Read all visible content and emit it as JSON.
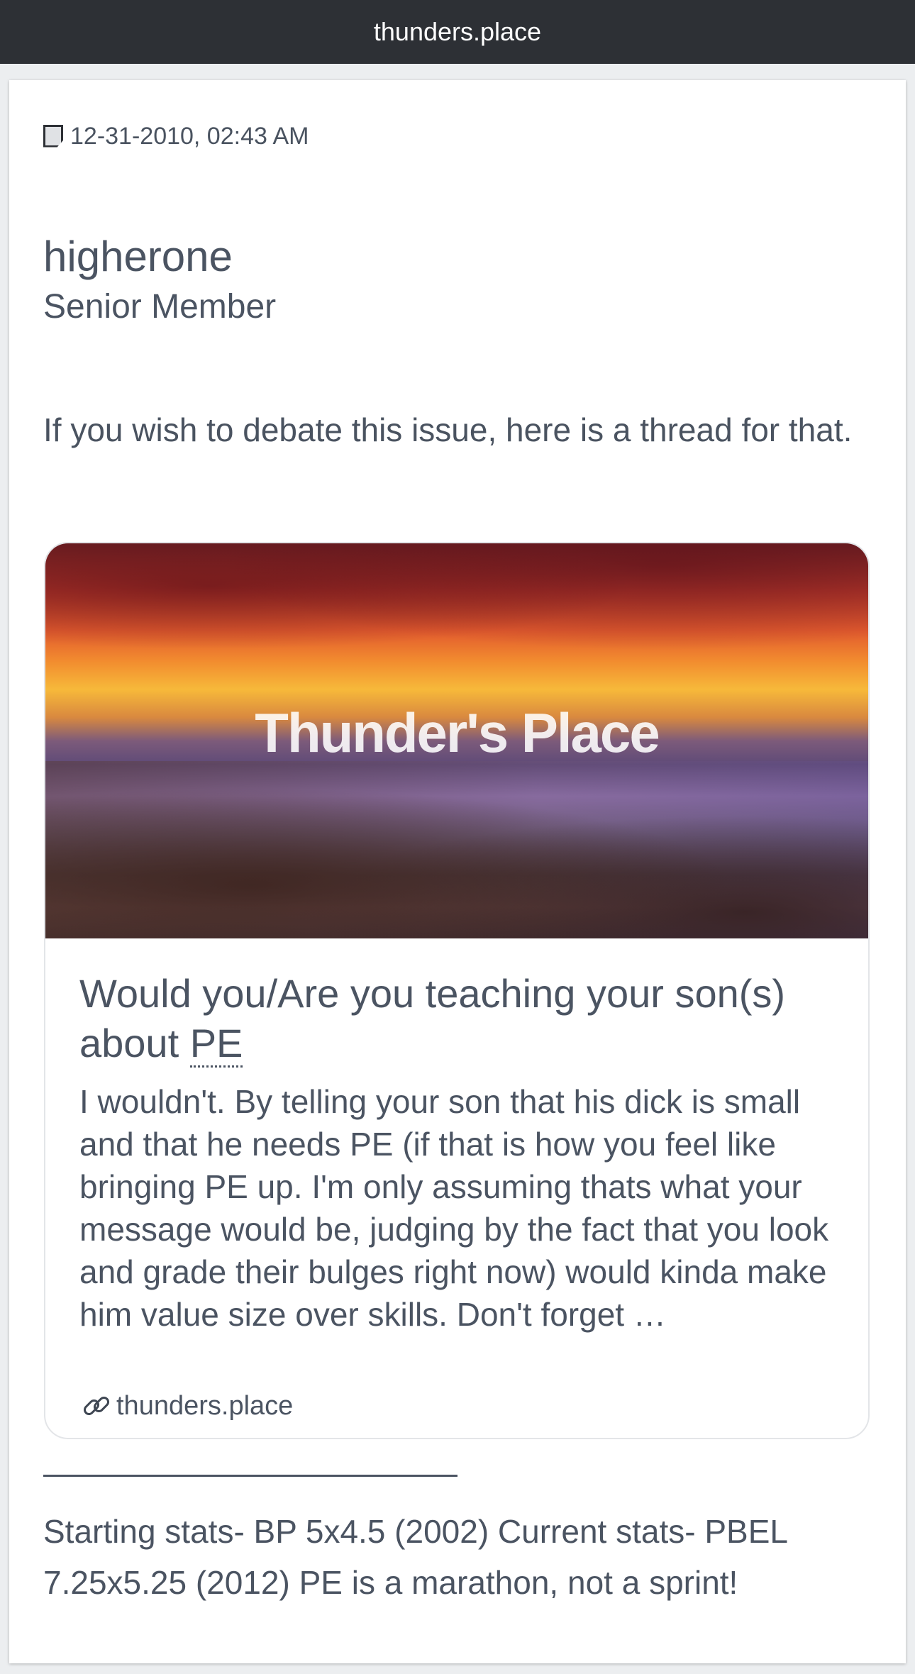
{
  "topbar": {
    "domain": "thunders.place"
  },
  "post": {
    "date": "12-31-2010, 02:43 AM",
    "username": "higherone",
    "user_title": "Senior Member",
    "body": "If you wish to debate this issue, here is a thread for that.",
    "link_card": {
      "banner_wordmark": "Thunder's Place",
      "title_before": "Would you/Are you teaching your son(s) about ",
      "title_abbr": "PE",
      "description": "I wouldn't. By telling your son that his dick is small and that he needs PE (if that is how you feel like bringing PE up. I'm only assuming thats what your message would be, judging by the fact that you look and grade their bulges right now) would kinda make him value size over skills. Don't forget …",
      "domain": "thunders.place"
    },
    "signature": "Starting stats- BP 5x4.5 (2002) Current stats- PBEL 7.25x5.25 (2012) PE is a marathon, not a sprint!"
  }
}
